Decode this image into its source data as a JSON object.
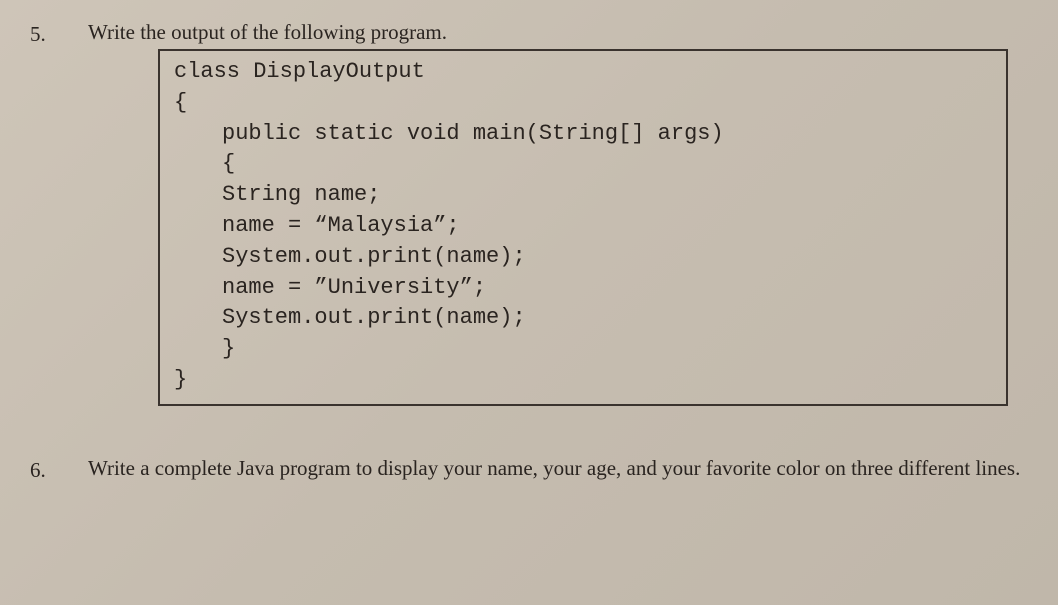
{
  "question5": {
    "number": "5.",
    "prompt": "Write the output of the following program.",
    "code": {
      "l1": "class DisplayOutput",
      "l2": "{",
      "l3": "public static void main(String[] args)",
      "l4": "{",
      "l5": "String name;",
      "l6": "name = “Malaysia”;",
      "l7": "System.out.print(name);",
      "l8": "name = ”University”;",
      "l9": "System.out.print(name);",
      "l10": "}",
      "l11": "}"
    }
  },
  "question6": {
    "number": "6.",
    "prompt": "Write a complete Java program to display your name, your age, and your favorite color on three different lines."
  }
}
